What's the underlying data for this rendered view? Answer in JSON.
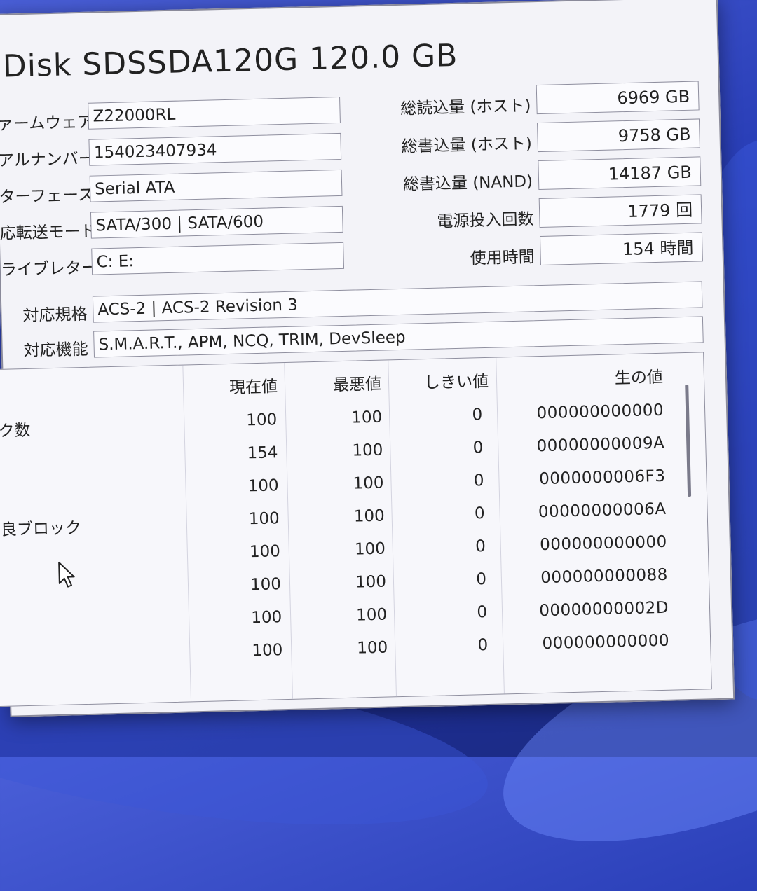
{
  "drive_title": "Disk SDSSDA120G 120.0 GB",
  "left_fields": [
    {
      "label": "ァームウェア",
      "value": "Z22000RL"
    },
    {
      "label": "アルナンバー",
      "value": "154023407934"
    },
    {
      "label": "ターフェース",
      "value": "Serial ATA"
    },
    {
      "label": "応転送モード",
      "value": "SATA/300 | SATA/600"
    },
    {
      "label": "ライブレター",
      "value": "C: E:"
    }
  ],
  "right_fields": [
    {
      "label": "総読込量 (ホスト)",
      "value": "6969 GB"
    },
    {
      "label": "総書込量 (ホスト)",
      "value": "9758 GB"
    },
    {
      "label": "総書込量 (NAND)",
      "value": "14187 GB"
    },
    {
      "label": "電源投入回数",
      "value": "1779 回"
    },
    {
      "label": "使用時間",
      "value": "154 時間"
    }
  ],
  "standard": {
    "label": "対応規格",
    "value": "ACS-2 | ACS-2 Revision 3"
  },
  "features": {
    "label": "対応機能",
    "value": "S.M.A.R.T., APM, NCQ, TRIM, DevSleep"
  },
  "smart_table": {
    "headers": {
      "current": "現在値",
      "worst": "最悪値",
      "threshold": "しきい値",
      "raw": "生の値"
    },
    "rows": [
      {
        "name": "ク数",
        "current": "100",
        "worst": "100",
        "threshold": "0",
        "raw": "000000000000"
      },
      {
        "name": "",
        "current": "154",
        "worst": "100",
        "threshold": "0",
        "raw": "00000000009A"
      },
      {
        "name": "",
        "current": "100",
        "worst": "100",
        "threshold": "0",
        "raw": "0000000006F3"
      },
      {
        "name": "良ブロック",
        "current": "100",
        "worst": "100",
        "threshold": "0",
        "raw": "00000000006A"
      },
      {
        "name": "",
        "current": "100",
        "worst": "100",
        "threshold": "0",
        "raw": "000000000000"
      },
      {
        "name": "",
        "current": "100",
        "worst": "100",
        "threshold": "0",
        "raw": "000000000088"
      },
      {
        "name": "",
        "current": "100",
        "worst": "100",
        "threshold": "0",
        "raw": "00000000002D"
      },
      {
        "name": "",
        "current": "100",
        "worst": "100",
        "threshold": "0",
        "raw": "000000000000"
      }
    ]
  },
  "icons": {
    "cursor": "mouse-pointer-icon"
  }
}
